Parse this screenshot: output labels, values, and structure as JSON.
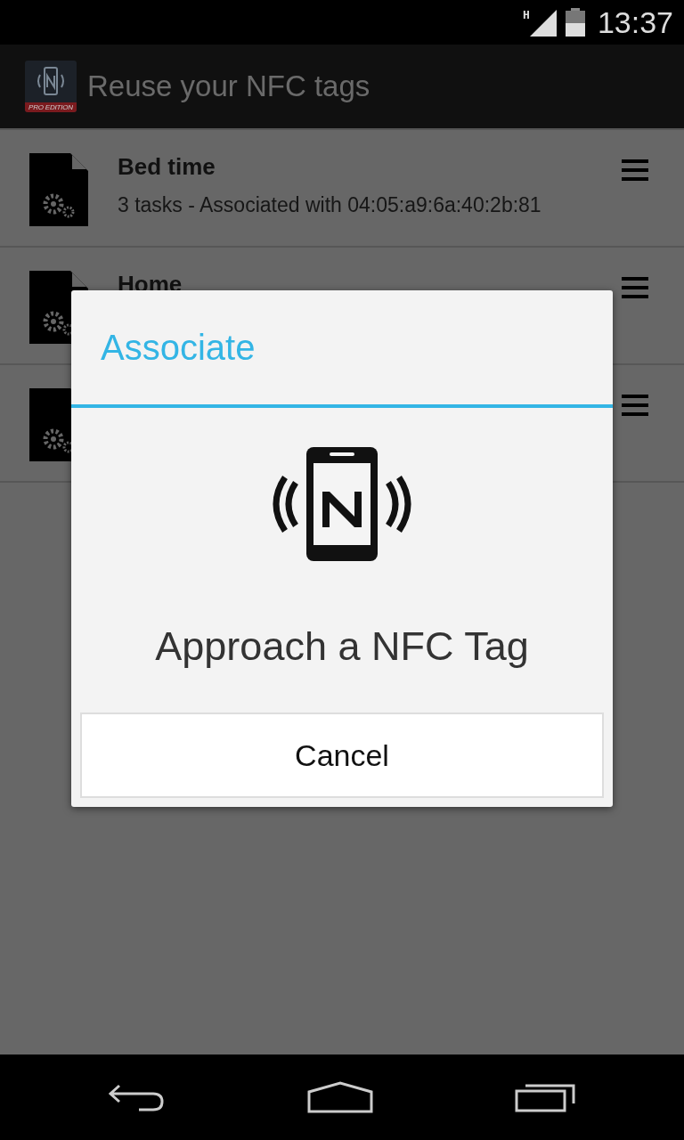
{
  "status_bar": {
    "network": "H",
    "time": "13:37"
  },
  "action_bar": {
    "title": "Reuse your NFC tags",
    "badge": "PRO EDITION"
  },
  "list": [
    {
      "kind": "task",
      "title": "Bed time",
      "subtitle": "3 tasks - Associated with 04:05:a9:6a:40:2b:81"
    },
    {
      "kind": "task",
      "title": "Home"
    },
    {
      "kind": "task"
    }
  ],
  "dialog": {
    "title": "Associate",
    "message": "Approach a NFC Tag",
    "buttons": [
      "Cancel"
    ]
  }
}
